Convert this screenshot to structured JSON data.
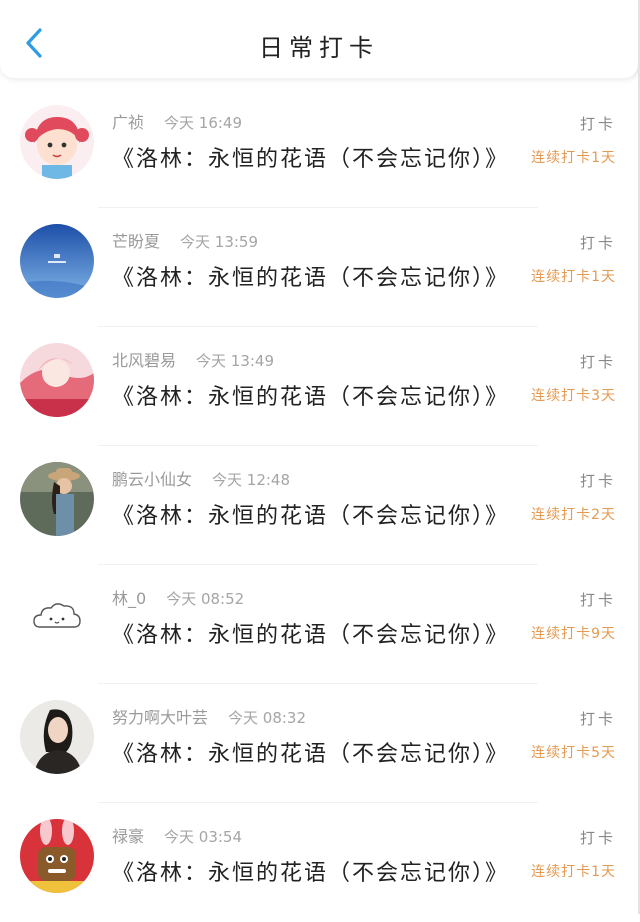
{
  "header": {
    "title": "日常打卡",
    "back_icon": "chevron-left-icon",
    "accent": "#2e9be6"
  },
  "colors": {
    "streak": "#e59a52",
    "muted": "#9a9a9a"
  },
  "entries": [
    {
      "user": "广祯",
      "time": "今天 16:49",
      "book": "《洛林：永恒的花语（不会忘记你）》",
      "action": "打卡",
      "streak": "连续打卡1天",
      "avatar": "cartoon-girl-avatar"
    },
    {
      "user": "芒盼夏",
      "time": "今天 13:59",
      "book": "《洛林：永恒的花语（不会忘记你）》",
      "action": "打卡",
      "streak": "连续打卡1天",
      "avatar": "blue-sky-avatar"
    },
    {
      "user": "北风碧易",
      "time": "今天 13:49",
      "book": "《洛林：永恒的花语（不会忘记你）》",
      "action": "打卡",
      "streak": "连续打卡3天",
      "avatar": "anime-girl-avatar"
    },
    {
      "user": "鹏云小仙女",
      "time": "今天 12:48",
      "book": "《洛林：永恒的花语（不会忘记你）》",
      "action": "打卡",
      "streak": "连续打卡2天",
      "avatar": "girl-hat-avatar"
    },
    {
      "user": "林_0",
      "time": "今天 08:52",
      "book": "《洛林：永恒的花语（不会忘记你）》",
      "action": "打卡",
      "streak": "连续打卡9天",
      "avatar": "cloud-avatar"
    },
    {
      "user": "努力啊大叶芸",
      "time": "今天 08:32",
      "book": "《洛林：永恒的花语（不会忘记你）》",
      "action": "打卡",
      "streak": "连续打卡5天",
      "avatar": "woman-portrait-avatar"
    },
    {
      "user": "禄豪",
      "time": "今天 03:54",
      "book": "《洛林：永恒的花语（不会忘记你）》",
      "action": "打卡",
      "streak": "连续打卡1天",
      "avatar": "bunny-cartoon-avatar"
    }
  ]
}
